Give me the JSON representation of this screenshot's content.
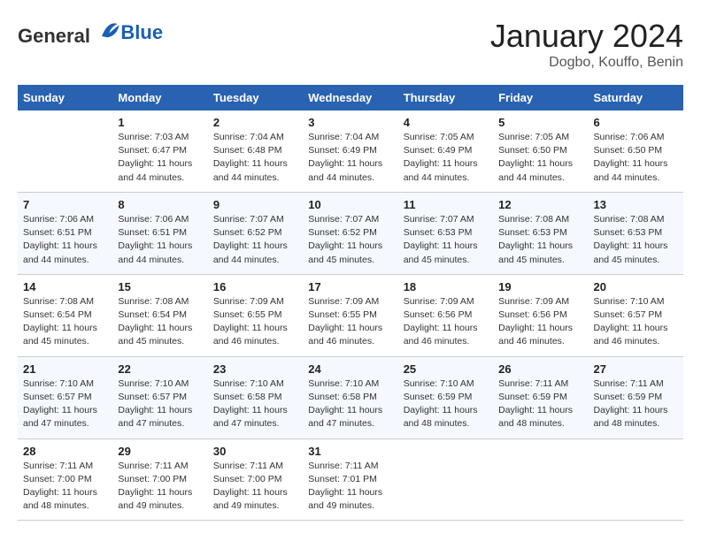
{
  "logo": {
    "general": "General",
    "blue": "Blue"
  },
  "title": "January 2024",
  "subtitle": "Dogbo, Kouffo, Benin",
  "days_of_week": [
    "Sunday",
    "Monday",
    "Tuesday",
    "Wednesday",
    "Thursday",
    "Friday",
    "Saturday"
  ],
  "weeks": [
    [
      {
        "day": "",
        "info": ""
      },
      {
        "day": "1",
        "info": "Sunrise: 7:03 AM\nSunset: 6:47 PM\nDaylight: 11 hours and 44 minutes."
      },
      {
        "day": "2",
        "info": "Sunrise: 7:04 AM\nSunset: 6:48 PM\nDaylight: 11 hours and 44 minutes."
      },
      {
        "day": "3",
        "info": "Sunrise: 7:04 AM\nSunset: 6:49 PM\nDaylight: 11 hours and 44 minutes."
      },
      {
        "day": "4",
        "info": "Sunrise: 7:05 AM\nSunset: 6:49 PM\nDaylight: 11 hours and 44 minutes."
      },
      {
        "day": "5",
        "info": "Sunrise: 7:05 AM\nSunset: 6:50 PM\nDaylight: 11 hours and 44 minutes."
      },
      {
        "day": "6",
        "info": "Sunrise: 7:06 AM\nSunset: 6:50 PM\nDaylight: 11 hours and 44 minutes."
      }
    ],
    [
      {
        "day": "7",
        "info": "Sunrise: 7:06 AM\nSunset: 6:51 PM\nDaylight: 11 hours and 44 minutes."
      },
      {
        "day": "8",
        "info": "Sunrise: 7:06 AM\nSunset: 6:51 PM\nDaylight: 11 hours and 44 minutes."
      },
      {
        "day": "9",
        "info": "Sunrise: 7:07 AM\nSunset: 6:52 PM\nDaylight: 11 hours and 44 minutes."
      },
      {
        "day": "10",
        "info": "Sunrise: 7:07 AM\nSunset: 6:52 PM\nDaylight: 11 hours and 45 minutes."
      },
      {
        "day": "11",
        "info": "Sunrise: 7:07 AM\nSunset: 6:53 PM\nDaylight: 11 hours and 45 minutes."
      },
      {
        "day": "12",
        "info": "Sunrise: 7:08 AM\nSunset: 6:53 PM\nDaylight: 11 hours and 45 minutes."
      },
      {
        "day": "13",
        "info": "Sunrise: 7:08 AM\nSunset: 6:53 PM\nDaylight: 11 hours and 45 minutes."
      }
    ],
    [
      {
        "day": "14",
        "info": "Sunrise: 7:08 AM\nSunset: 6:54 PM\nDaylight: 11 hours and 45 minutes."
      },
      {
        "day": "15",
        "info": "Sunrise: 7:08 AM\nSunset: 6:54 PM\nDaylight: 11 hours and 45 minutes."
      },
      {
        "day": "16",
        "info": "Sunrise: 7:09 AM\nSunset: 6:55 PM\nDaylight: 11 hours and 46 minutes."
      },
      {
        "day": "17",
        "info": "Sunrise: 7:09 AM\nSunset: 6:55 PM\nDaylight: 11 hours and 46 minutes."
      },
      {
        "day": "18",
        "info": "Sunrise: 7:09 AM\nSunset: 6:56 PM\nDaylight: 11 hours and 46 minutes."
      },
      {
        "day": "19",
        "info": "Sunrise: 7:09 AM\nSunset: 6:56 PM\nDaylight: 11 hours and 46 minutes."
      },
      {
        "day": "20",
        "info": "Sunrise: 7:10 AM\nSunset: 6:57 PM\nDaylight: 11 hours and 46 minutes."
      }
    ],
    [
      {
        "day": "21",
        "info": "Sunrise: 7:10 AM\nSunset: 6:57 PM\nDaylight: 11 hours and 47 minutes."
      },
      {
        "day": "22",
        "info": "Sunrise: 7:10 AM\nSunset: 6:57 PM\nDaylight: 11 hours and 47 minutes."
      },
      {
        "day": "23",
        "info": "Sunrise: 7:10 AM\nSunset: 6:58 PM\nDaylight: 11 hours and 47 minutes."
      },
      {
        "day": "24",
        "info": "Sunrise: 7:10 AM\nSunset: 6:58 PM\nDaylight: 11 hours and 47 minutes."
      },
      {
        "day": "25",
        "info": "Sunrise: 7:10 AM\nSunset: 6:59 PM\nDaylight: 11 hours and 48 minutes."
      },
      {
        "day": "26",
        "info": "Sunrise: 7:11 AM\nSunset: 6:59 PM\nDaylight: 11 hours and 48 minutes."
      },
      {
        "day": "27",
        "info": "Sunrise: 7:11 AM\nSunset: 6:59 PM\nDaylight: 11 hours and 48 minutes."
      }
    ],
    [
      {
        "day": "28",
        "info": "Sunrise: 7:11 AM\nSunset: 7:00 PM\nDaylight: 11 hours and 48 minutes."
      },
      {
        "day": "29",
        "info": "Sunrise: 7:11 AM\nSunset: 7:00 PM\nDaylight: 11 hours and 49 minutes."
      },
      {
        "day": "30",
        "info": "Sunrise: 7:11 AM\nSunset: 7:00 PM\nDaylight: 11 hours and 49 minutes."
      },
      {
        "day": "31",
        "info": "Sunrise: 7:11 AM\nSunset: 7:01 PM\nDaylight: 11 hours and 49 minutes."
      },
      {
        "day": "",
        "info": ""
      },
      {
        "day": "",
        "info": ""
      },
      {
        "day": "",
        "info": ""
      }
    ]
  ]
}
